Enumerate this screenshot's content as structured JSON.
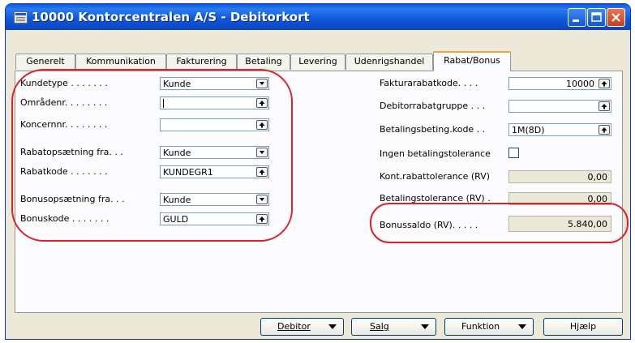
{
  "window": {
    "title": "10000 Kontorcentralen A/S - Debitorkort"
  },
  "tabs": [
    {
      "label": "Generelt"
    },
    {
      "label": "Kommunikation"
    },
    {
      "label": "Fakturering"
    },
    {
      "label": "Betaling"
    },
    {
      "label": "Levering"
    },
    {
      "label": "Udenrigshandel"
    },
    {
      "label": "Rabat/Bonus"
    }
  ],
  "left": {
    "kundetype": {
      "label": "Kundetype . . . . . . .",
      "value": "Kunde",
      "icon": "dropdown-icon"
    },
    "omraadenr": {
      "label": "Områdenr. . . . . . . .",
      "value": "",
      "icon": "lookup-icon"
    },
    "koncernnr": {
      "label": "Koncernnr. . . . . . . .",
      "value": "",
      "icon": "lookup-icon"
    },
    "rabatops": {
      "label": "Rabatopsætning fra. . .",
      "value": "Kunde",
      "icon": "dropdown-icon"
    },
    "rabatkode": {
      "label": "Rabatkode . . . . . . .",
      "value": "KUNDEGR1",
      "icon": "lookup-icon"
    },
    "bonusops": {
      "label": "Bonusopsætning fra. . .",
      "value": "Kunde",
      "icon": "dropdown-icon"
    },
    "bonuskode": {
      "label": "Bonuskode . . . . . . .",
      "value": "GULD",
      "icon": "lookup-icon"
    }
  },
  "right": {
    "fakturarabatkode": {
      "label": "Fakturarabatkode. . . .",
      "value": "10000"
    },
    "debitorrabatgruppe": {
      "label": "Debitorrabatgruppe . . .",
      "value": ""
    },
    "betalingsbeting": {
      "label": "Betalingsbeting.kode . .",
      "value": "1M(8D)"
    },
    "ingen_betalingstolerance": {
      "label": "Ingen betalingstolerance",
      "checked": false
    },
    "kont_rabattolerance": {
      "label": "Kont.rabattolerance (RV)",
      "value": "0,00"
    },
    "betalingstolerance": {
      "label": "Betalingstolerance (RV) .",
      "value": "0,00"
    },
    "bonussaldo": {
      "label": "Bonussaldo (RV). . . . .",
      "value": "5.840,00"
    }
  },
  "buttons": {
    "debitor": {
      "label": "Debitor"
    },
    "salg": {
      "label": "Salg"
    },
    "funktion": {
      "label": "Funktion"
    },
    "hjaelp": {
      "label": "Hjælp"
    }
  },
  "colors": {
    "annotation": "#d9232a",
    "titlebar": "#0a5ad6",
    "active_tab_accent": "#f0a33c"
  }
}
